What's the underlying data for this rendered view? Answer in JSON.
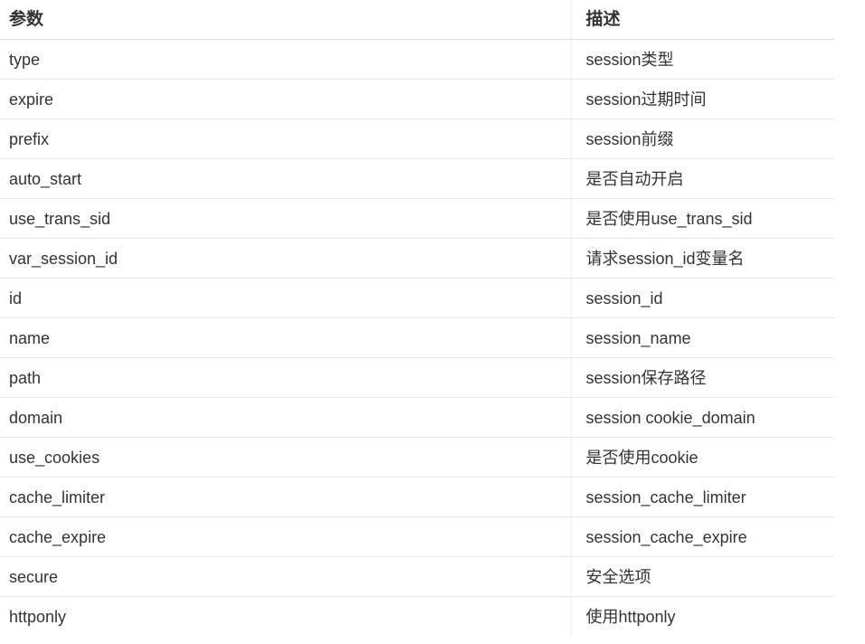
{
  "table": {
    "headers": {
      "param": "参数",
      "desc": "描述"
    },
    "rows": [
      {
        "param": "type",
        "desc": "session类型"
      },
      {
        "param": "expire",
        "desc": "session过期时间"
      },
      {
        "param": "prefix",
        "desc": "session前缀"
      },
      {
        "param": "auto_start",
        "desc": "是否自动开启"
      },
      {
        "param": "use_trans_sid",
        "desc": "是否使用use_trans_sid"
      },
      {
        "param": "var_session_id",
        "desc": "请求session_id变量名"
      },
      {
        "param": "id",
        "desc": "session_id"
      },
      {
        "param": "name",
        "desc": "session_name"
      },
      {
        "param": "path",
        "desc": "session保存路径"
      },
      {
        "param": "domain",
        "desc": "session cookie_domain"
      },
      {
        "param": "use_cookies",
        "desc": "是否使用cookie"
      },
      {
        "param": "cache_limiter",
        "desc": "session_cache_limiter"
      },
      {
        "param": "cache_expire",
        "desc": "session_cache_expire"
      },
      {
        "param": "secure",
        "desc": "安全选项"
      },
      {
        "param": "httponly",
        "desc": "使用httponly"
      }
    ]
  }
}
